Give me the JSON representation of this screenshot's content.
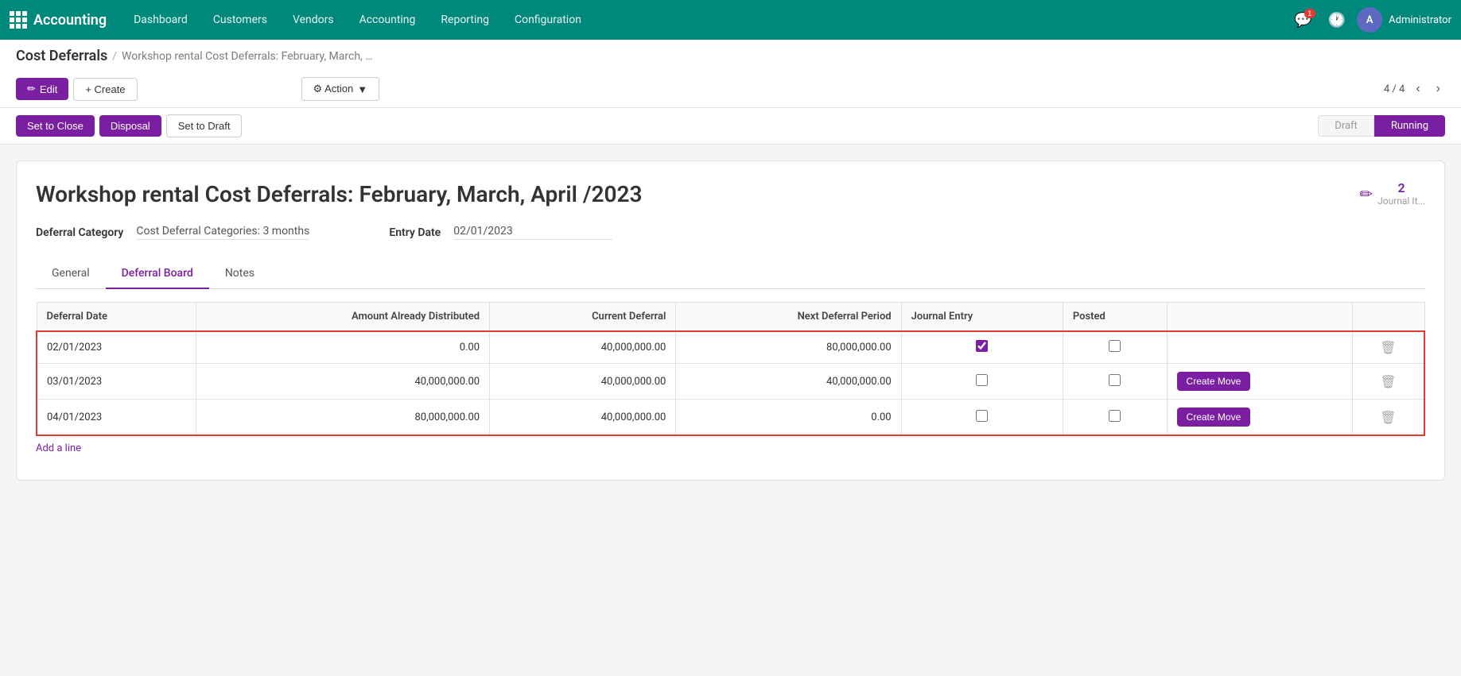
{
  "app": {
    "name": "Accounting"
  },
  "nav": {
    "links": [
      "Dashboard",
      "Customers",
      "Vendors",
      "Accounting",
      "Reporting",
      "Configuration"
    ],
    "user": "Administrator",
    "user_initial": "A",
    "notification_count": "1"
  },
  "breadcrumb": {
    "main": "Cost Deferrals",
    "sub": "Workshop rental Cost Deferrals: February, March, …"
  },
  "toolbar": {
    "edit_label": "Edit",
    "create_label": "+ Create",
    "action_label": "⚙ Action",
    "pager": "4 / 4"
  },
  "status_buttons": {
    "set_to_close": "Set to Close",
    "disposal": "Disposal",
    "set_to_draft": "Set to Draft",
    "status_draft": "Draft",
    "status_running": "Running"
  },
  "record": {
    "title": "Workshop rental Cost Deferrals: February, March, April /2023",
    "journal_count": "2",
    "journal_label": "Journal It...",
    "deferral_category_label": "Deferral Category",
    "deferral_category_value": "Cost Deferral Categories: 3 months",
    "entry_date_label": "Entry Date",
    "entry_date_value": "02/01/2023"
  },
  "tabs": [
    {
      "label": "General",
      "active": false
    },
    {
      "label": "Deferral Board",
      "active": true
    },
    {
      "label": "Notes",
      "active": false
    }
  ],
  "table": {
    "headers": [
      {
        "label": "Deferral Date"
      },
      {
        "label": "Amount Already Distributed",
        "right": true
      },
      {
        "label": "Current Deferral",
        "right": true
      },
      {
        "label": "Next Deferral Period",
        "right": true
      },
      {
        "label": "Journal Entry"
      },
      {
        "label": "Posted"
      }
    ],
    "rows": [
      {
        "date": "02/01/2023",
        "amount_distributed": "0.00",
        "current_deferral": "40,000,000.00",
        "next_period": "80,000,000.00",
        "journal_checked": true,
        "posted_checked": false,
        "has_create_move": false
      },
      {
        "date": "03/01/2023",
        "amount_distributed": "40,000,000.00",
        "current_deferral": "40,000,000.00",
        "next_period": "40,000,000.00",
        "journal_checked": false,
        "posted_checked": false,
        "has_create_move": true,
        "create_move_label": "Create Move"
      },
      {
        "date": "04/01/2023",
        "amount_distributed": "80,000,000.00",
        "current_deferral": "40,000,000.00",
        "next_period": "0.00",
        "journal_checked": false,
        "posted_checked": false,
        "has_create_move": true,
        "create_move_label": "Create Move"
      }
    ],
    "add_line_label": "Add a line"
  }
}
